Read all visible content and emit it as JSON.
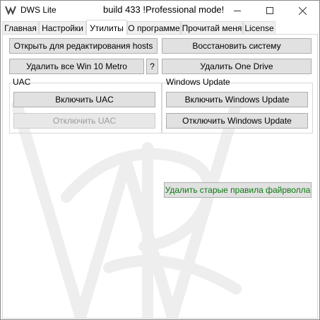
{
  "window": {
    "app_title": "DWS Lite",
    "build_title": "build 433  !Professional mode!"
  },
  "tabs": [
    {
      "label": "Главная"
    },
    {
      "label": "Настройки"
    },
    {
      "label": "Утилиты",
      "active": true
    },
    {
      "label": "О программе"
    },
    {
      "label": "Прочитай меня"
    },
    {
      "label": "License"
    }
  ],
  "utilities": {
    "open_hosts": "Открыть для редактирования hosts",
    "restore_system": "Восстановить систему",
    "remove_metro": "Удалить все Win 10 Metro",
    "help": "?",
    "remove_onedrive": "Удалить One Drive",
    "uac": {
      "label": "UAC",
      "enable": "Включить UAC",
      "disable": "Отключить UAC"
    },
    "windows_update": {
      "label": "Windows Update",
      "enable": "Включить Windows Update",
      "disable": "Отключить Windows Update"
    },
    "remove_firewall_rules": "Удалить старые правила файрволла"
  },
  "colors": {
    "accent_green": "#0b7a10",
    "disabled_text": "#9a9a9a",
    "button_face": "#e1e1e1"
  }
}
